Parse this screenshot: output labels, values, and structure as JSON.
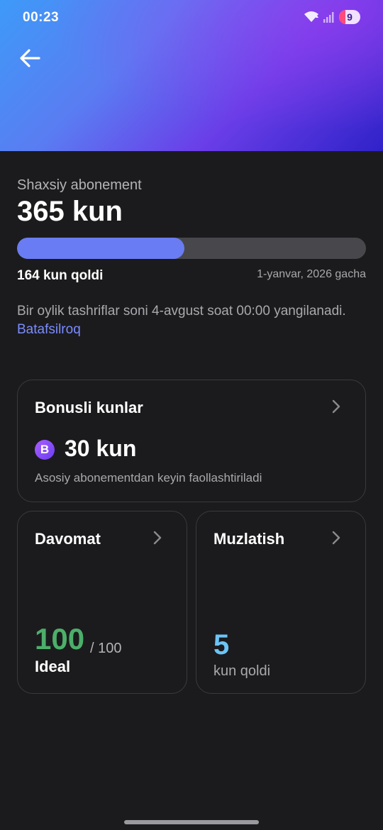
{
  "status_bar": {
    "time": "00:23",
    "battery_level": "9",
    "icons": [
      "wifi-icon",
      "signal-icon",
      "battery-icon"
    ]
  },
  "header": {
    "back_icon": "arrow-left-icon",
    "gradient_colors": [
      "#3e9af8",
      "#6a3ee8",
      "#2f22c8"
    ]
  },
  "subscription": {
    "label": "Shaxsiy abonement",
    "duration": "365 kun",
    "progress_fraction": 0.48,
    "days_left": "164 kun qoldi",
    "valid_until": "1-yanvar, 2026 gacha",
    "info_text": "Bir oylik tashriflar soni 4-avgust soat 00:00 yangilanadi.",
    "info_link": "Batafsilroq"
  },
  "bonus_card": {
    "title": "Bonusli kunlar",
    "badge_letter": "B",
    "value": "30 kun",
    "note": "Asosiy abonementdan keyin faollashtiriladi"
  },
  "attendance_card": {
    "title": "Davomat",
    "value": "100",
    "max": "/ 100",
    "label": "Ideal",
    "value_color": "#4caf6a"
  },
  "freeze_card": {
    "title": "Muzlatish",
    "value": "5",
    "label": "kun qoldi",
    "value_color": "#6cc4f6"
  },
  "colors": {
    "background": "#1b1b1d",
    "accent": "#6a7cf3",
    "link": "#7b8cff"
  }
}
